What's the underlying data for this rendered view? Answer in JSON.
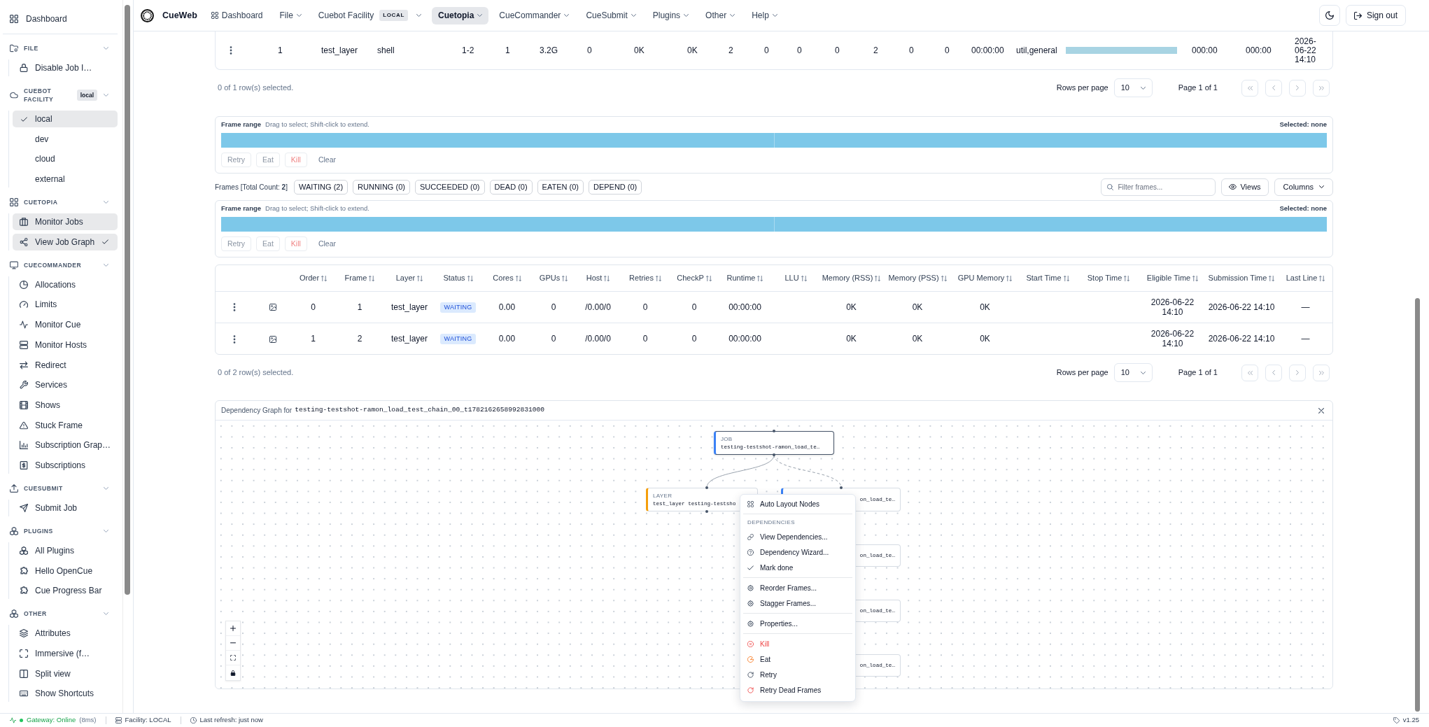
{
  "navbar": {
    "brand": "CueWeb",
    "items": [
      {
        "label": "Dashboard",
        "selected": false,
        "dropdown": false
      },
      {
        "label": "File",
        "selected": false,
        "dropdown": true
      },
      {
        "label": "Cuebot Facility",
        "badge": "LOCAL",
        "selected": false,
        "dropdown": true
      },
      {
        "label": "Cuetopia",
        "selected": true,
        "dropdown": true
      },
      {
        "label": "CueCommander",
        "selected": false,
        "dropdown": true
      },
      {
        "label": "CueSubmit",
        "selected": false,
        "dropdown": true
      },
      {
        "label": "Plugins",
        "selected": false,
        "dropdown": true
      },
      {
        "label": "Other",
        "selected": false,
        "dropdown": true
      },
      {
        "label": "Help",
        "selected": false,
        "dropdown": true
      }
    ],
    "sign_out": "Sign out"
  },
  "sidebar": {
    "home": {
      "label": "Dashboard"
    },
    "sections": [
      {
        "title": "FILE",
        "kind": "links",
        "expanded": true,
        "items": [
          {
            "label": "Disable Job I…",
            "active": false,
            "selected": false
          }
        ]
      },
      {
        "title": "CUEBOT FACILITY",
        "badge": "local",
        "kind": "options",
        "expanded": true,
        "items": [
          {
            "label": "local",
            "selected": true
          },
          {
            "label": "dev",
            "selected": false
          },
          {
            "label": "cloud",
            "selected": false
          },
          {
            "label": "external",
            "selected": false
          }
        ]
      },
      {
        "title": "CUETOPIA",
        "kind": "links",
        "expanded": true,
        "items": [
          {
            "label": "Monitor Jobs",
            "active": true,
            "selected": false
          },
          {
            "label": "View Job Graph",
            "active": true,
            "selected": true
          }
        ]
      },
      {
        "title": "CUECOMMANDER",
        "kind": "links",
        "expanded": true,
        "items": [
          {
            "label": "Allocations",
            "active": false,
            "selected": false
          },
          {
            "label": "Limits",
            "active": false,
            "selected": false
          },
          {
            "label": "Monitor Cue",
            "active": false,
            "selected": false
          },
          {
            "label": "Monitor Hosts",
            "active": false,
            "selected": false
          },
          {
            "label": "Redirect",
            "active": false,
            "selected": false
          },
          {
            "label": "Services",
            "active": false,
            "selected": false
          },
          {
            "label": "Shows",
            "active": false,
            "selected": false
          },
          {
            "label": "Stuck Frame",
            "active": false,
            "selected": false
          },
          {
            "label": "Subscription Grap…",
            "active": false,
            "selected": false
          },
          {
            "label": "Subscriptions",
            "active": false,
            "selected": false
          }
        ]
      },
      {
        "title": "CUESUBMIT",
        "kind": "links",
        "expanded": true,
        "items": [
          {
            "label": "Submit Job",
            "active": false,
            "selected": false
          }
        ]
      },
      {
        "title": "PLUGINS",
        "kind": "links",
        "expanded": true,
        "items": [
          {
            "label": "All Plugins",
            "active": false,
            "selected": false
          },
          {
            "label": "Hello OpenCue",
            "active": false,
            "selected": false
          },
          {
            "label": "Cue Progress Bar",
            "active": false,
            "selected": false
          }
        ]
      },
      {
        "title": "OTHER",
        "kind": "links",
        "expanded": true,
        "items": [
          {
            "label": "Attributes",
            "active": false,
            "selected": false
          },
          {
            "label": "Immersive (f…",
            "active": false,
            "selected": false
          },
          {
            "label": "Split view",
            "active": false,
            "selected": false
          },
          {
            "label": "Show Shortcuts",
            "active": false,
            "selected": false
          }
        ]
      }
    ]
  },
  "layer_table": {
    "rows": [
      {
        "cells": [
          {
            "kind": "text",
            "text": "1"
          },
          {
            "kind": "text",
            "text": "test_layer"
          },
          {
            "kind": "text",
            "text": "shell"
          },
          {
            "kind": "text",
            "text": "1-2"
          },
          {
            "kind": "text",
            "text": "1"
          },
          {
            "kind": "text",
            "text": "3.2G"
          },
          {
            "kind": "text",
            "text": "0"
          },
          {
            "kind": "text",
            "text": "0K"
          },
          {
            "kind": "text",
            "text": "0K"
          },
          {
            "kind": "text",
            "text": "2"
          },
          {
            "kind": "text",
            "text": "0"
          },
          {
            "kind": "text",
            "text": "0"
          },
          {
            "kind": "text",
            "text": "0"
          },
          {
            "kind": "text",
            "text": "2"
          },
          {
            "kind": "text",
            "text": "0"
          },
          {
            "kind": "text",
            "text": "0"
          },
          {
            "kind": "text",
            "text": "00:00:00"
          },
          {
            "kind": "text",
            "text": "util,general"
          },
          {
            "kind": "bar",
            "level": 1
          },
          {
            "kind": "text",
            "text": "000:00"
          },
          {
            "kind": "text",
            "text": "000:00"
          },
          {
            "kind": "text",
            "text": "2026-06-22 14:10"
          }
        ]
      }
    ]
  },
  "layer_pager": {
    "selection_text": "0 of 1 row(s) selected.",
    "rows_per_page_label": "Rows per page",
    "rows_per_page": "10",
    "page_text": "Page 1 of 1",
    "buttons": [
      {
        "kind": "first",
        "disabled": true
      },
      {
        "kind": "previous",
        "disabled": true
      },
      {
        "kind": "next",
        "disabled": true
      },
      {
        "kind": "last",
        "disabled": true
      }
    ]
  },
  "frame_range_panels": [
    {
      "label": "Frame range",
      "hint": "Drag to select; Shift-click to extend.",
      "selection": "Selected: none",
      "segments": [
        {
          "selected": false
        },
        {
          "selected": false
        }
      ],
      "actions": [
        {
          "label": "Retry",
          "kind": "outline",
          "disabled": true
        },
        {
          "label": "Eat",
          "kind": "outline",
          "disabled": true
        },
        {
          "label": "Kill",
          "kind": "danger",
          "disabled": true
        },
        {
          "label": "Clear",
          "kind": "plain",
          "disabled": false
        }
      ]
    },
    {
      "label": "Frame range",
      "hint": "Drag to select; Shift-click to extend.",
      "selection": "Selected: none",
      "segments": [
        {
          "selected": false
        },
        {
          "selected": false
        }
      ],
      "actions": [
        {
          "label": "Retry",
          "kind": "outline",
          "disabled": true
        },
        {
          "label": "Eat",
          "kind": "outline",
          "disabled": true
        },
        {
          "label": "Kill",
          "kind": "danger",
          "disabled": true
        },
        {
          "label": "Clear",
          "kind": "plain",
          "disabled": false
        }
      ]
    }
  ],
  "frames_toolbar": {
    "summary": "Frames [Total Count: **2**]",
    "status_filters": [
      {
        "label": "WAITING (2)",
        "selected": false
      },
      {
        "label": "RUNNING (0)",
        "selected": false
      },
      {
        "label": "SUCCEEDED (0)",
        "selected": false
      },
      {
        "label": "DEAD (0)",
        "selected": false
      },
      {
        "label": "EATEN (0)",
        "selected": false
      },
      {
        "label": "DEPEND (0)",
        "selected": false
      }
    ],
    "filter_field": {
      "placeholder": "Filter frames..."
    },
    "views_button": "Views",
    "columns_button": "Columns"
  },
  "frames_table": {
    "columns": [
      {
        "label": "Order",
        "sortable": true
      },
      {
        "label": "Frame",
        "sortable": true
      },
      {
        "label": "Layer",
        "sortable": true
      },
      {
        "label": "Status",
        "sortable": true
      },
      {
        "label": "Cores",
        "sortable": true
      },
      {
        "label": "GPUs",
        "sortable": true
      },
      {
        "label": "Host",
        "sortable": true
      },
      {
        "label": "Retries",
        "sortable": true
      },
      {
        "label": "CheckP",
        "sortable": true
      },
      {
        "label": "Runtime",
        "sortable": true
      },
      {
        "label": "LLU",
        "sortable": true
      },
      {
        "label": "Memory (RSS)",
        "sortable": true
      },
      {
        "label": "Memory (PSS)",
        "sortable": true
      },
      {
        "label": "GPU Memory",
        "sortable": true
      },
      {
        "label": "Start Time",
        "sortable": true
      },
      {
        "label": "Stop Time",
        "sortable": true
      },
      {
        "label": "Eligible Time",
        "sortable": true
      },
      {
        "label": "Submission Time",
        "sortable": true
      },
      {
        "label": "Last Line",
        "sortable": true
      }
    ],
    "rows": [
      {
        "order": "0",
        "frame": "1",
        "layer": "test_layer",
        "status": "WAITING",
        "cores": "0.00",
        "gpus": "0",
        "host": "/0.00/0",
        "retries": "0",
        "checkp": "0",
        "runtime": "00:00:00",
        "memory_rss": "0K",
        "memory_pss": "0K",
        "gpu_memory": "0K",
        "eligible_time": "2026-06-22 14:10",
        "submission_time": "2026-06-22 14:10",
        "last_line": "—"
      },
      {
        "order": "1",
        "frame": "2",
        "layer": "test_layer",
        "status": "WAITING",
        "cores": "0.00",
        "gpus": "0",
        "host": "/0.00/0",
        "retries": "0",
        "checkp": "0",
        "runtime": "00:00:00",
        "memory_rss": "0K",
        "memory_pss": "0K",
        "gpu_memory": "0K",
        "eligible_time": "2026-06-22 14:10",
        "submission_time": "2026-06-22 14:10",
        "last_line": "—"
      }
    ]
  },
  "frames_pager": {
    "selection_text": "0 of 2 row(s) selected.",
    "rows_per_page_label": "Rows per page",
    "rows_per_page": "10",
    "page_text": "Page 1 of 1",
    "buttons": [
      {
        "kind": "first",
        "disabled": true
      },
      {
        "kind": "previous",
        "disabled": true
      },
      {
        "kind": "next",
        "disabled": true
      },
      {
        "kind": "last",
        "disabled": true
      }
    ]
  },
  "dependency_graph": {
    "title": "Dependency Graph for",
    "job_name": "testing-testshot-ramon_load_test_chain_00_t1782162658992831000",
    "nodes": [
      {
        "kind": "job",
        "type_label": "JOB",
        "name": "testing-testshot-ramon_load_te…",
        "selected": true
      },
      {
        "kind": "layer",
        "type_label": "LAYER",
        "name": "test_layer testing-testsho",
        "selected": false
      },
      {
        "kind": "job",
        "name": "on_load_te…",
        "selected": false
      },
      {
        "kind": "job",
        "name": "on_load_te…",
        "selected": false
      },
      {
        "kind": "job",
        "name": "on_load_te…",
        "selected": false
      },
      {
        "kind": "job",
        "name": "on_load_te…",
        "selected": false
      }
    ],
    "edges": [
      {
        "kind": "solid"
      },
      {
        "kind": "dashed"
      }
    ],
    "context_menu": {
      "items": [
        {
          "kind": "item",
          "label": "Auto Layout Nodes",
          "danger": false
        },
        {
          "kind": "divider"
        },
        {
          "kind": "header",
          "label": "DEPENDENCIES"
        },
        {
          "kind": "item",
          "label": "View Dependencies...",
          "danger": false
        },
        {
          "kind": "item",
          "label": "Dependency Wizard...",
          "danger": false
        },
        {
          "kind": "item",
          "label": "Mark done",
          "danger": false
        },
        {
          "kind": "divider"
        },
        {
          "kind": "item",
          "label": "Reorder Frames...",
          "danger": false
        },
        {
          "kind": "item",
          "label": "Stagger Frames...",
          "danger": false
        },
        {
          "kind": "divider"
        },
        {
          "kind": "item",
          "label": "Properties...",
          "danger": false
        },
        {
          "kind": "divider"
        },
        {
          "kind": "item",
          "label": "Kill",
          "danger": true
        },
        {
          "kind": "item",
          "label": "Eat",
          "danger": false
        },
        {
          "kind": "item",
          "label": "Retry",
          "danger": false
        },
        {
          "kind": "item",
          "label": "Retry Dead Frames",
          "danger": false
        }
      ]
    }
  },
  "status_bar": {
    "gateway": {
      "text": "Gateway: Online",
      "latency": "(8ms)",
      "online": true
    },
    "facility": "Facility: LOCAL",
    "last_refresh": "Last refresh: just now",
    "version": "v1.25"
  }
}
